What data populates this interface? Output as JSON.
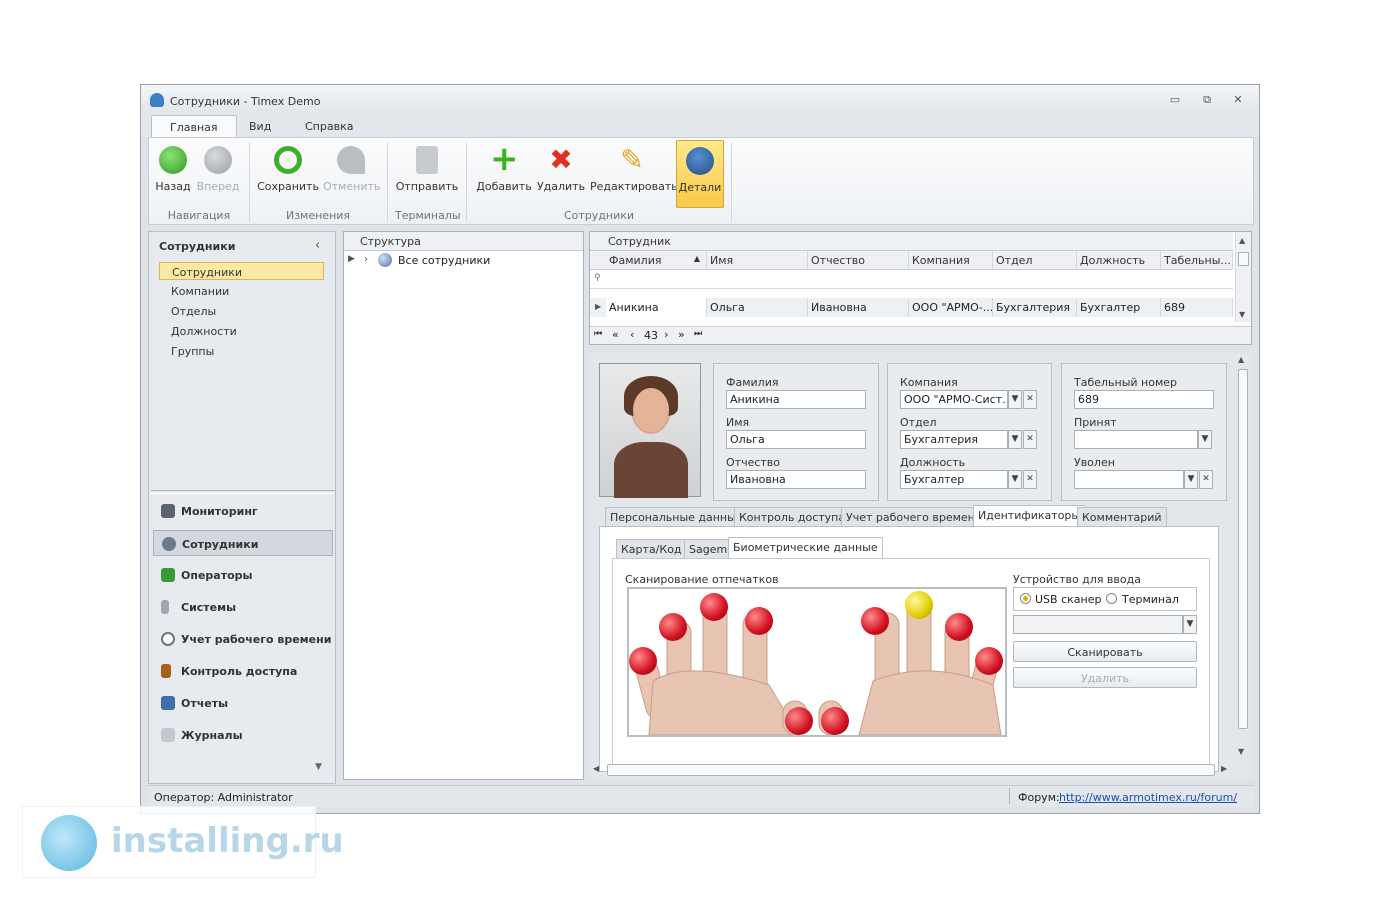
{
  "window": {
    "title": "Сотрудники - Timex Demo",
    "min": "▭",
    "restore": "⧉",
    "close": "✕"
  },
  "menu": [
    "Главная",
    "Вид",
    "Справка"
  ],
  "ribbon": {
    "buttons": {
      "back": "Назад",
      "forward": "Вперед",
      "save": "Сохранить",
      "undo": "Отменить",
      "send": "Отправить",
      "add": "Добавить",
      "delete": "Удалить",
      "edit": "Редактировать",
      "details": "Детали"
    },
    "groups": {
      "nav": "Навигация",
      "changes": "Изменения",
      "terminals": "Терминалы",
      "employees": "Сотрудники"
    }
  },
  "nav": {
    "header": "Сотрудники",
    "collapse": "‹",
    "items": [
      "Сотрудники",
      "Компании",
      "Отделы",
      "Должности",
      "Группы"
    ]
  },
  "modules": [
    "Мониторинг",
    "Сотрудники",
    "Операторы",
    "Системы",
    "Учет рабочего времени",
    "Контроль доступа",
    "Отчеты",
    "Журналы"
  ],
  "structure": {
    "header": "Структура",
    "root": "Все сотрудники"
  },
  "grid": {
    "band": "Сотрудник",
    "columns": [
      "Фамилия",
      "Имя",
      "Отчество",
      "Компания",
      "Отдел",
      "Должность",
      "Табельны..."
    ],
    "row": [
      "Аникина",
      "Ольга",
      "Ивановна",
      "ООО \"АРМО-...",
      "Бухгалтерия",
      "Бухгалтер",
      "689"
    ],
    "page": "43",
    "nav_first": "⏮",
    "nav_prev_page": "«",
    "nav_prev": "‹",
    "nav_next": "›",
    "nav_next_page": "»",
    "nav_last": "⏭"
  },
  "details": {
    "lastname_label": "Фамилия",
    "lastname": "Аникина",
    "firstname_label": "Имя",
    "firstname": "Ольга",
    "middlename_label": "Отчество",
    "middlename": "Ивановна",
    "company_label": "Компания",
    "company": "ООО \"АРМО-Сист...",
    "dept_label": "Отдел",
    "dept": "Бухгалтерия",
    "position_label": "Должность",
    "position": "Бухгалтер",
    "tabnum_label": "Табельный номер",
    "tabnum": "689",
    "hired_label": "Принят",
    "hired": "",
    "fired_label": "Уволен",
    "fired": ""
  },
  "tabs": [
    "Персональные данные",
    "Контроль доступа",
    "Учет рабочего времени",
    "Идентификаторы",
    "Комментарий"
  ],
  "subtabs": [
    "Карта/Код",
    "Sagem",
    "Биометрические данные"
  ],
  "bio": {
    "scan_label": "Сканирование отпечатков",
    "device_label": "Устройство для ввода отпечатков",
    "usb": "USB сканер",
    "terminal": "Терминал",
    "scan_btn": "Сканировать",
    "delete_btn": "Удалить"
  },
  "status": {
    "operator": "Оператор: Administrator",
    "forum_label": "Форум:",
    "forum_link": "http://www.armotimex.ru/forum/"
  },
  "watermark": "installing.ru",
  "colors": {
    "accent": "#fde9a6",
    "finger_red": "#d10f1f",
    "finger_selected": "#e3cc00",
    "link": "#1a4fb3"
  }
}
